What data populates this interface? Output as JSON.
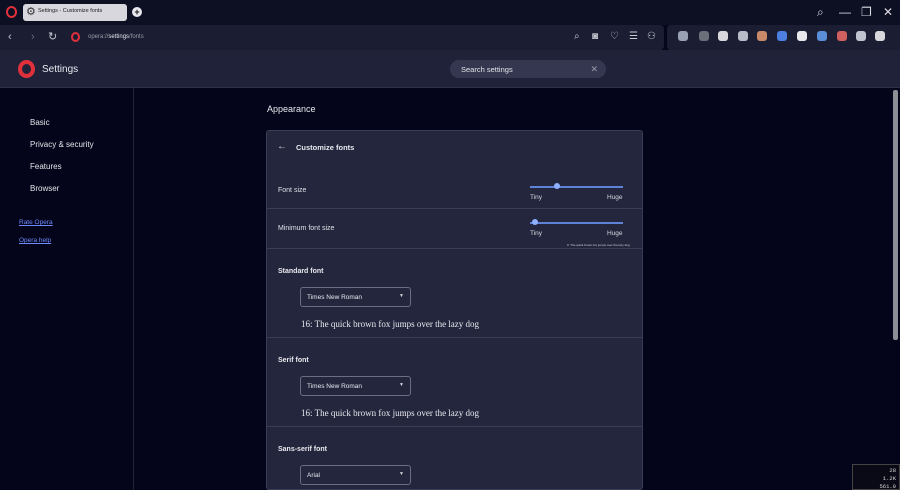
{
  "tab": {
    "title": "Settings - Customize fonts"
  },
  "address": {
    "scheme": "opera://",
    "path": "settings",
    "suffix": "/fonts"
  },
  "header": {
    "title": "Settings"
  },
  "search": {
    "placeholder": "Search settings"
  },
  "sidebar": {
    "items": [
      {
        "label": "Basic"
      },
      {
        "label": "Privacy & security"
      },
      {
        "label": "Features"
      },
      {
        "label": "Browser"
      }
    ],
    "links": [
      {
        "label": "Rate Opera"
      },
      {
        "label": "Opera help"
      }
    ]
  },
  "main": {
    "section_title": "Appearance",
    "card_title": "Customize fonts",
    "font_size": {
      "label": "Font size",
      "min_label": "Tiny",
      "max_label": "Huge",
      "level": 0.29
    },
    "min_font_size": {
      "label": "Minimum font size",
      "min_label": "Tiny",
      "max_label": "Huge",
      "level": 0.05,
      "preview": "0: The quick brown fox jumps over the lazy dog"
    },
    "standard_font": {
      "heading": "Standard font",
      "value": "Times New Roman",
      "sample": "16: The quick brown fox jumps over the lazy dog"
    },
    "serif_font": {
      "heading": "Serif font",
      "value": "Times New Roman",
      "sample": "16: The quick brown fox jumps over the lazy dog"
    },
    "sans_serif_font": {
      "heading": "Sans-serif font",
      "value": "Arial"
    }
  },
  "fps_overlay": {
    "line1": "28",
    "line2": "1.2K",
    "line3": "561.0"
  },
  "colors": {
    "accent": "#e0313b",
    "slider": "#5d82d6",
    "link": "#6f8cff"
  }
}
